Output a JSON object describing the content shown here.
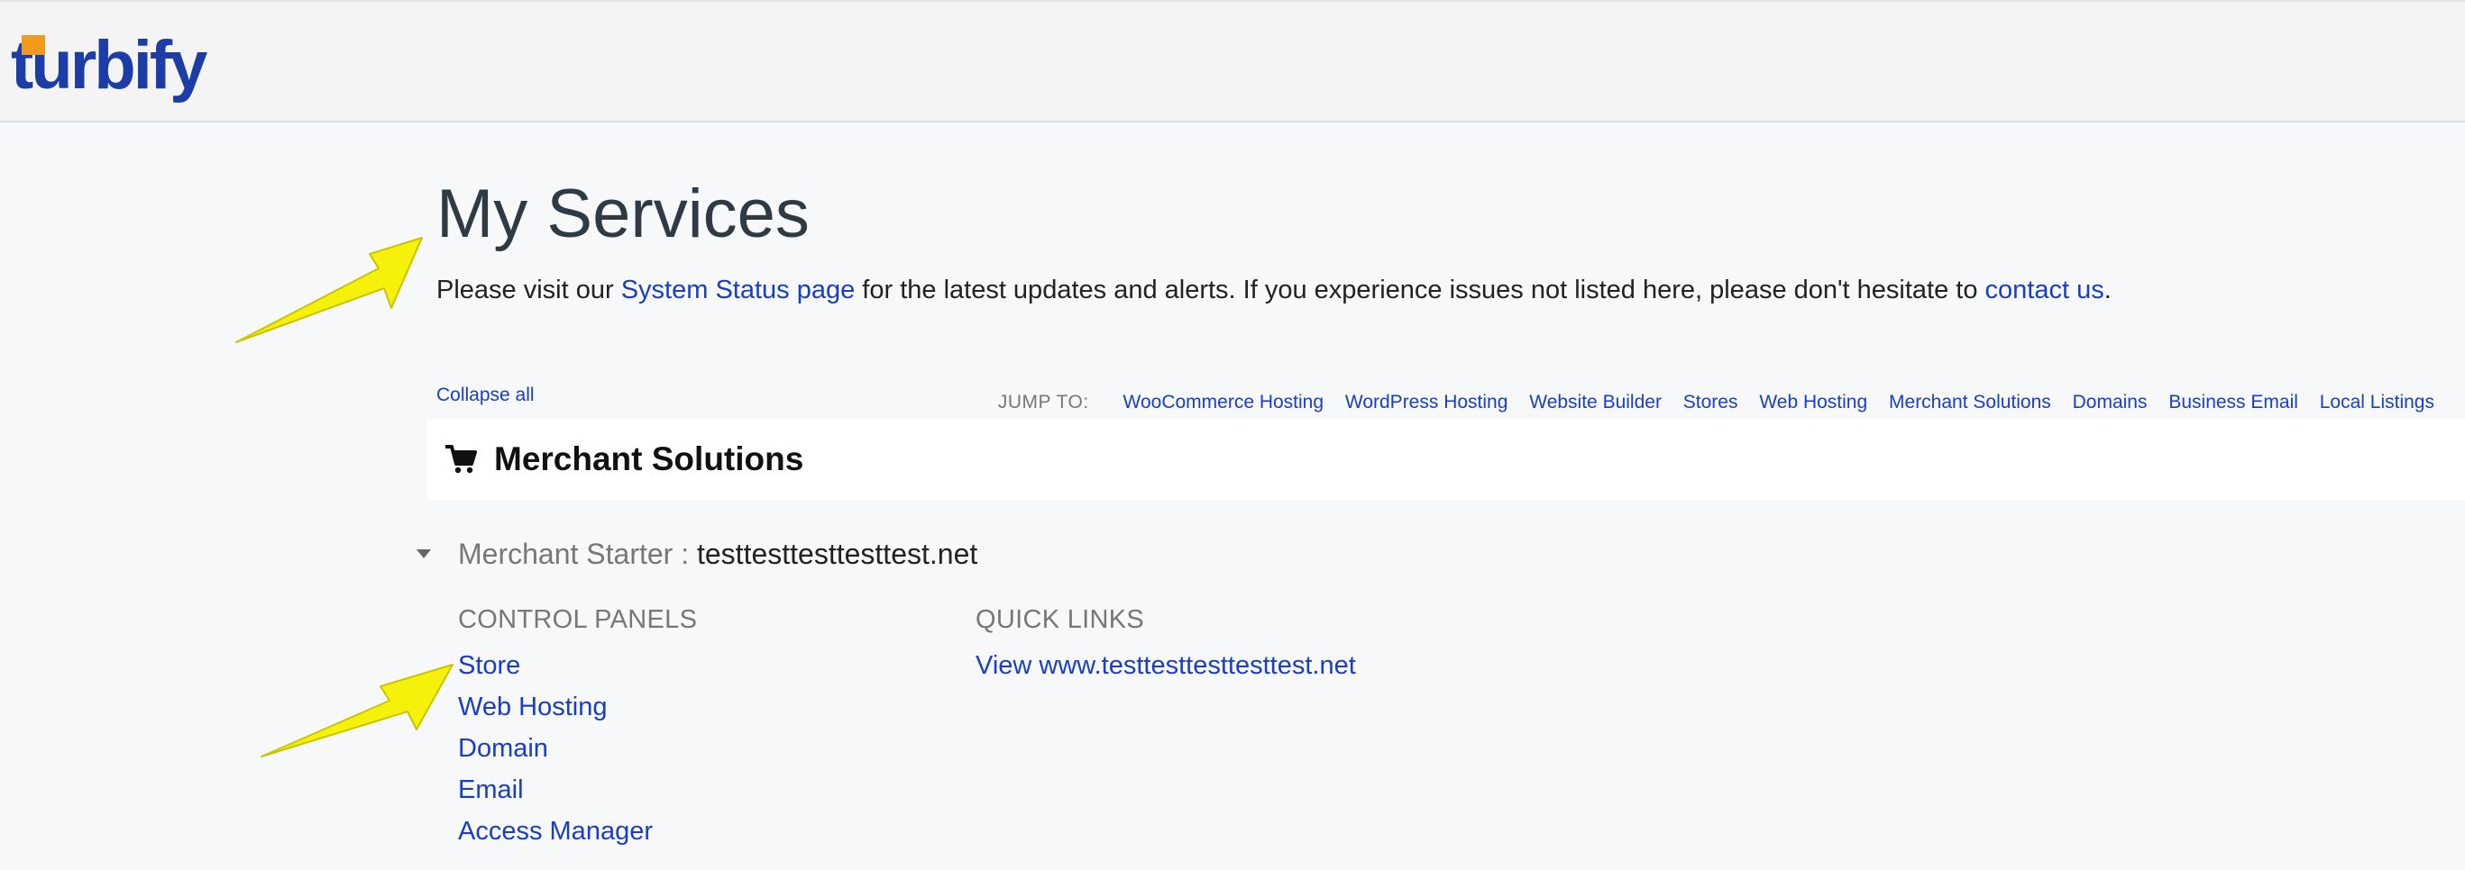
{
  "header": {
    "logo_text": "turbify",
    "logo_accent_color": "#f39a1e",
    "logo_color": "#1c3ca8"
  },
  "page": {
    "title": "My Services",
    "intro_before": "Please visit our ",
    "status_link": "System Status page",
    "intro_middle": " for the latest updates and alerts. If you experience issues not listed here, please don't hesitate to ",
    "contact_link": "contact us",
    "intro_after": ".",
    "collapse_all": "Collapse all"
  },
  "jump": {
    "label": "JUMP TO:",
    "links": [
      "WooCommerce Hosting",
      "WordPress Hosting",
      "Website Builder",
      "Stores",
      "Web Hosting",
      "Merchant Solutions",
      "Domains",
      "Business Email",
      "Local Listings"
    ]
  },
  "section": {
    "icon": "cart-icon",
    "title": "Merchant Solutions"
  },
  "plan": {
    "name": "Merchant Starter :",
    "domain": "testtesttesttesttest.net"
  },
  "control_panels": {
    "heading": "CONTROL PANELS",
    "links": [
      "Store",
      "Web Hosting",
      "Domain",
      "Email",
      "Access Manager"
    ]
  },
  "quick_links": {
    "heading": "QUICK LINKS",
    "links": [
      "View www.testtesttesttesttest.net"
    ]
  },
  "annotation": {
    "arrow_color": "#f5f10a"
  }
}
